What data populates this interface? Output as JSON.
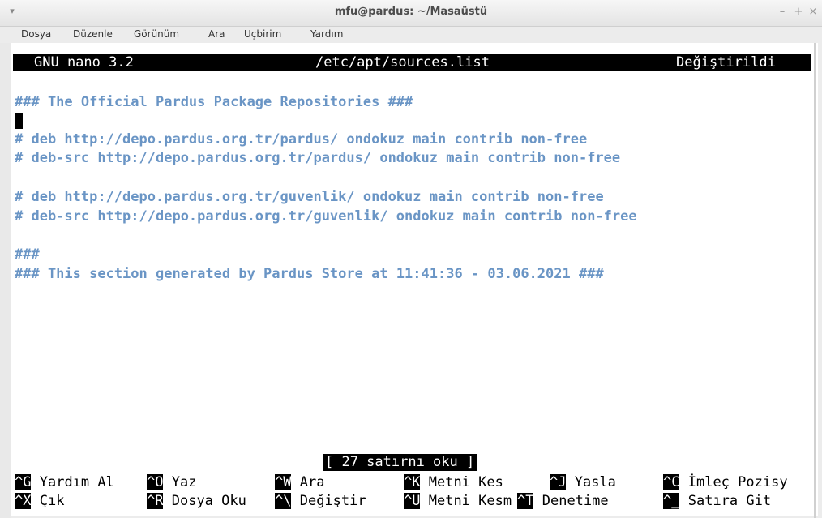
{
  "window": {
    "title": "mfu@pardus: ~/Masaüstü",
    "menu_glyph": "▾",
    "minimize": "–",
    "maximize": "+",
    "close": "×"
  },
  "menubar": [
    "Dosya",
    "Düzenle",
    "Görünüm",
    "Ara",
    "Uçbirim",
    "Yardım"
  ],
  "nano": {
    "version": "GNU nano 3.2",
    "filename": "/etc/apt/sources.list",
    "state": "Değiştirildi"
  },
  "file_lines": [
    "### The Official Pardus Package Repositories ###",
    "",
    "# deb http://depo.pardus.org.tr/pardus/ ondokuz main contrib non-free",
    "# deb-src http://depo.pardus.org.tr/pardus/ ondokuz main contrib non-free",
    "",
    "# deb http://depo.pardus.org.tr/guvenlik/ ondokuz main contrib non-free",
    "# deb-src http://depo.pardus.org.tr/guvenlik/ ondokuz main contrib non-free",
    "",
    "###",
    "### This section generated by Pardus Store at 11:41:36 - 03.06.2021 ###"
  ],
  "status_message": "[ 27 satırnı oku ]",
  "shortcuts_row1": [
    {
      "key": "^G",
      "label": "Yardım Al"
    },
    {
      "key": "^O",
      "label": "Yaz"
    },
    {
      "key": "^W",
      "label": "Ara"
    },
    {
      "key": "^K",
      "label": "Metni Kes"
    },
    {
      "key": "^J",
      "label": "Yasla"
    },
    {
      "key": "^C",
      "label": "İmleç Pozisy"
    }
  ],
  "shortcuts_row2": [
    {
      "key": "^X",
      "label": "Çık"
    },
    {
      "key": "^R",
      "label": "Dosya Oku"
    },
    {
      "key": "^\\",
      "label": "Değiştir"
    },
    {
      "key": "^U",
      "label": "Metni Kesm"
    },
    {
      "key": "^T",
      "label": "Denetime"
    },
    {
      "key": "^_",
      "label": "Satıra Git"
    }
  ]
}
